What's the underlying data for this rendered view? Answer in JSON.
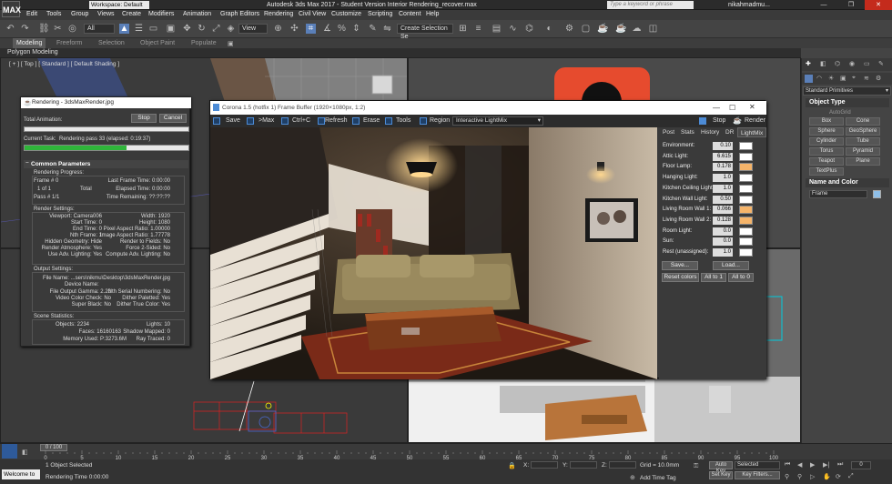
{
  "app": {
    "logo": "MAX",
    "workspace": "Workspace: Default",
    "title": "Autodesk 3ds Max 2017 - Student Version   Interior Rendering_recover.max",
    "search_placeholder": "Type a keyword or phrase",
    "user": "nikahmadmu...",
    "window_buttons": [
      "—",
      "❐",
      "✕"
    ]
  },
  "menu": [
    "Edit",
    "Tools",
    "Group",
    "Views",
    "Create",
    "Modifiers",
    "Animation",
    "Graph Editors",
    "Rendering",
    "Civil View",
    "Customize",
    "Scripting",
    "Content",
    "Help"
  ],
  "toolbar": {
    "filter": "All",
    "view": "View",
    "selection_set": "Create Selection Se"
  },
  "ribbon": {
    "tabs": [
      "Modeling",
      "Freeform",
      "Selection",
      "Object Paint",
      "Populate"
    ],
    "active": "Modeling",
    "sub": "Polygon Modeling"
  },
  "viewport_top_label": "[ + ] [ Top ] [ Standard ] [ Default Shading ]",
  "command_panel": {
    "dropdown": "Standard Primitives",
    "object_type_title": "Object Type",
    "autogrid": "AutoGrid",
    "buttons": [
      "Box",
      "Cone",
      "Sphere",
      "GeoSphere",
      "Cylinder",
      "Tube",
      "Torus",
      "Pyramid",
      "Teapot",
      "Plane",
      "TextPlus"
    ],
    "name_color_title": "Name and Color",
    "name_value": "Frame"
  },
  "render_dialog": {
    "title": "Rendering - 3dsMaxRender.jpg",
    "total_animation": "Total Animation:",
    "stop": "Stop",
    "cancel": "Cancel",
    "current_task_label": "Current Task:",
    "current_task": "Rendering pass 33 (elapsed: 0:19:37)",
    "progress": 0.62,
    "common_params": "Common Parameters",
    "rendering_progress": "Rendering Progress:",
    "frame_label": "Frame #",
    "frame_value": "0",
    "of_label": "1 of 1",
    "total_label": "Total",
    "pass_label": "Pass #",
    "pass_value": "1/1",
    "last_frame_time": "Last Frame Time:  0:00:00",
    "elapsed_time": "Elapsed Time:  0:00:00",
    "time_remaining": "Time Remaining:  ??:??:??",
    "render_settings": "Render Settings:",
    "settings_left": [
      "Viewport: Camera006",
      "Start Time: 0",
      "End Time: 0",
      "Nth Frame: 1",
      "Hidden Geometry: Hide",
      "Render Atmosphere: Yes",
      "Use Adv. Lighting: Yes"
    ],
    "settings_right": [
      "Width: 1920",
      "Height: 1080",
      "Pixel Aspect Ratio: 1.00000",
      "Image Aspect Ratio: 1.77778",
      "Render to Fields: No",
      "Force 2-Sided: No",
      "Compute Adv. Lighting: No"
    ],
    "output_settings": "Output Settings:",
    "file_name": "File Name:  ...sers\\nikmu\\Desktop\\3dsMaxRender.jpg",
    "device_name": "Device Name:",
    "output_left": [
      "File Output Gamma: 2.20",
      "Video Color Check: No",
      "Super Black: No"
    ],
    "output_right": [
      "Nth Serial Numbering: No",
      "Dither Paletted: Yes",
      "Dither True Color: Yes"
    ],
    "scene_stats": "Scene Statistics:",
    "stats_left": [
      "Objects: 2234",
      "Faces: 16160163",
      "Memory Used: P:3273.6M"
    ],
    "stats_right": [
      "Lights: 10",
      "Shadow Mapped: 0",
      "Ray Traced: 0"
    ]
  },
  "frame_buffer": {
    "title": "Corona 1.5 (hotfix 1) Frame Buffer (1920×1080px, 1:2)",
    "tools": [
      "Save",
      ">Max",
      "Ctrl+C",
      "Refresh",
      "Erase",
      "Tools",
      "Region"
    ],
    "lightmix_dropdown": "Interactive LightMix",
    "stop": "Stop",
    "render": "Render",
    "tabs": [
      "Post",
      "Stats",
      "History",
      "DR",
      "LightMix"
    ],
    "active_tab": "LightMix",
    "lights": [
      {
        "name": "Environment:",
        "value": "0.10",
        "color": "#ffffff"
      },
      {
        "name": "Attic Light:",
        "value": "6.615",
        "color": "#ffffff"
      },
      {
        "name": "Floor Lamp:",
        "value": "0.178",
        "color": "#f5b46a"
      },
      {
        "name": "Hanging Light:",
        "value": "1.0",
        "color": "#ffffff"
      },
      {
        "name": "Kitchen Ceiling Light:",
        "value": "1.0",
        "color": "#ffffff"
      },
      {
        "name": "Kitchen Wall Light:",
        "value": "0.50",
        "color": "#ffffff"
      },
      {
        "name": "Living Room Wall 1:",
        "value": "0.066",
        "color": "#f5b46a"
      },
      {
        "name": "Living Room Wall 2:",
        "value": "0.128",
        "color": "#f5b46a"
      },
      {
        "name": "Room Light:",
        "value": "0.0",
        "color": "#ffffff"
      },
      {
        "name": "Sun:",
        "value": "0.0",
        "color": "#ffffff"
      },
      {
        "name": "Rest (unassigned):",
        "value": "1.0",
        "color": "#ffffff"
      }
    ],
    "save_btn": "Save...",
    "load_btn": "Load...",
    "reset_colors": "Reset colors",
    "all_to_1": "All to 1",
    "all_to_0": "All to 0"
  },
  "timeline": {
    "range": "0 / 100",
    "ticks": [
      "0",
      "5",
      "10",
      "15",
      "20",
      "25",
      "30",
      "35",
      "40",
      "45",
      "50",
      "55",
      "60",
      "65",
      "70",
      "75",
      "80",
      "85",
      "90",
      "95",
      "100"
    ]
  },
  "status": {
    "welcome": "Welcome to",
    "objects_selected": "1 Object Selected",
    "rendering_time": "Rendering Time  0:00:00",
    "x_label": "X:",
    "y_label": "Y:",
    "z_label": "Z:",
    "grid": "Grid = 10.0mm",
    "add_time_tag": "Add Time Tag",
    "auto_key": "Auto Key",
    "set_key": "Set Key",
    "selected": "Selected",
    "key_filters": "Key Filters...",
    "frame_field": "0"
  }
}
